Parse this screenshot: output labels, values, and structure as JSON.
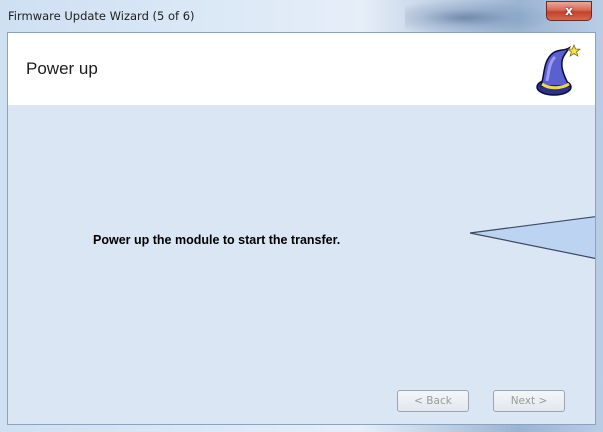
{
  "window": {
    "title": "Firmware Update Wizard (5 of 6)",
    "close_glyph": "x"
  },
  "header": {
    "title": "Power up",
    "icon": "wizard-hat-icon"
  },
  "content": {
    "instruction": "Power up the module to start the transfer."
  },
  "buttons": {
    "back": "< Back",
    "next": "Next >"
  },
  "colors": {
    "body_background": "#dbe6f4",
    "header_background": "#ffffff",
    "close_button": "#c5412c"
  }
}
